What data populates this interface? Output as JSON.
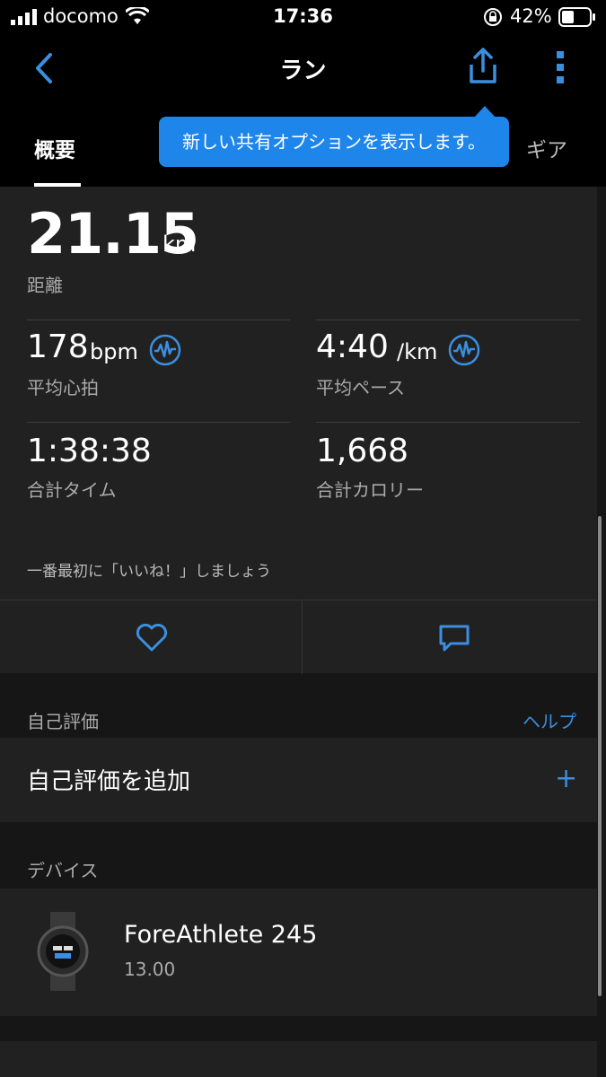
{
  "status_bar": {
    "carrier": "docomo",
    "time": "17:36",
    "battery": "42%"
  },
  "nav": {
    "title": "ラン",
    "back_icon": "chevron-left-icon",
    "share_icon": "share-icon",
    "more_icon": "more-vertical-icon"
  },
  "tabs": {
    "overview": "概要",
    "gear": "ギア"
  },
  "tooltip": "新しい共有オプションを表示します。",
  "distance": {
    "value": "21.15",
    "unit": "km",
    "label": "距離"
  },
  "stats": {
    "avg_hr": {
      "value": "178",
      "unit": "bpm",
      "label": "平均心拍"
    },
    "avg_pace": {
      "value": "4:40",
      "unit": "/km",
      "label": "平均ペース"
    },
    "total_time": {
      "value": "1:38:38",
      "label": "合計タイム"
    },
    "total_calories": {
      "value": "1,668",
      "label": "合計カロリー"
    }
  },
  "like_prompt": "一番最初に「いいね！」しましょう",
  "self_eval": {
    "header": "自己評価",
    "help": "ヘルプ",
    "add_label": "自己評価を追加",
    "add_icon": "+"
  },
  "devices": {
    "header": "デバイス",
    "name": "ForeAthlete 245",
    "version": "13.00"
  },
  "colors": {
    "accent": "#3b8fe0",
    "tooltip": "#1e86ea",
    "panel": "#212121",
    "background": "#161616"
  }
}
